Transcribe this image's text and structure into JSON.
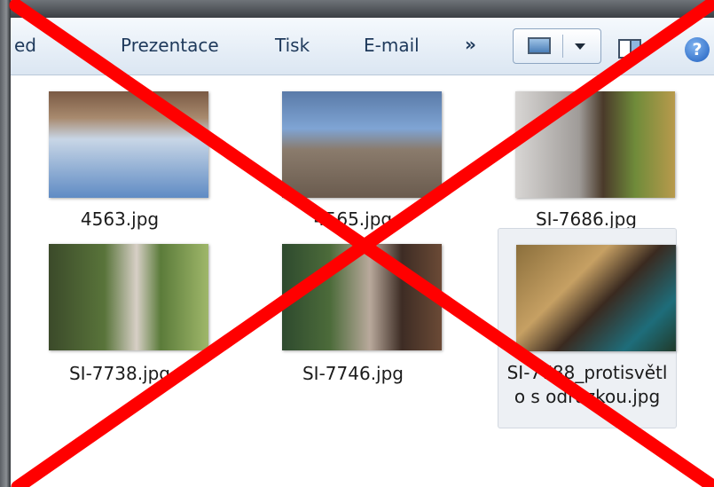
{
  "toolbar": {
    "items": [
      "ed",
      "Prezentace",
      "Tisk",
      "E-mail"
    ],
    "more": "»",
    "help": "?"
  },
  "files": [
    {
      "name": "4563.jpg"
    },
    {
      "name": "4565.jpg"
    },
    {
      "name": "SI-7686.jpg"
    },
    {
      "name": "SI-7738.jpg"
    },
    {
      "name": "SI-7746.jpg"
    },
    {
      "name_line1": "SI-7788_protisvětl",
      "name_line2": "o s odrazkou.jpg",
      "selected": true
    }
  ],
  "colors": {
    "accent": "#1e395b",
    "cross": "#ff0000"
  }
}
